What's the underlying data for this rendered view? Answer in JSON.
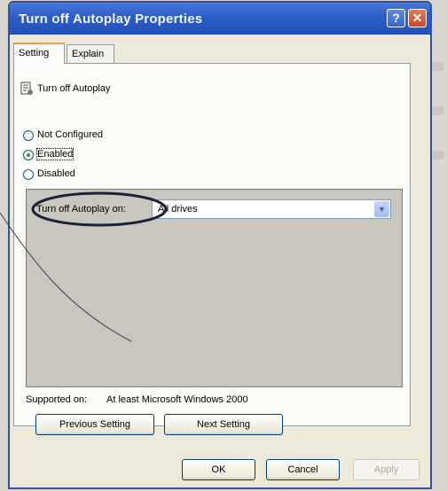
{
  "window": {
    "title": "Turn off Autoplay Properties",
    "help_label": "?",
    "close_label": "✕"
  },
  "tabs": [
    {
      "label": "Setting",
      "active": true
    },
    {
      "label": "Explain",
      "active": false
    }
  ],
  "policy": {
    "name": "Turn off Autoplay",
    "icon": "policy-icon"
  },
  "options": [
    {
      "label": "Not Configured",
      "checked": false
    },
    {
      "label": "Enabled",
      "checked": true
    },
    {
      "label": "Disabled",
      "checked": false
    }
  ],
  "autoplay_option": {
    "label": "Turn off Autoplay on:",
    "value": "All drives"
  },
  "supported": {
    "label": "Supported on:",
    "value": "At least Microsoft Windows 2000"
  },
  "nav_buttons": {
    "previous": "Previous Setting",
    "next": "Next Setting"
  },
  "dialog_buttons": {
    "ok": "OK",
    "cancel": "Cancel",
    "apply": "Apply"
  },
  "colors": {
    "titlebar": "#2d5fc9",
    "dialog_bg": "#ece9d8",
    "annotation": "#1b1f3a"
  }
}
